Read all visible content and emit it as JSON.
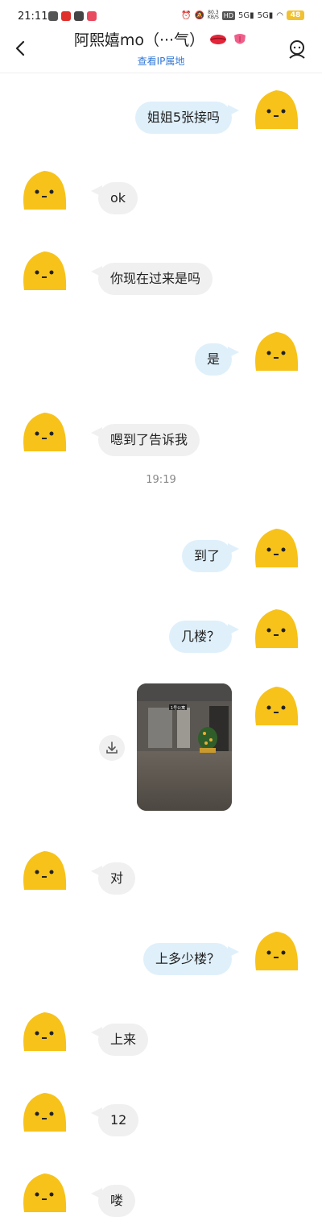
{
  "status_bar": {
    "time": "21:11",
    "app_icon_colors": [
      "#555555",
      "#e0302c",
      "#444444",
      "#e84a5f"
    ],
    "net_speed_value": "80.3",
    "net_speed_unit": "KB/S",
    "hd_badge": "HD",
    "signal1": "5G",
    "signal2": "5G",
    "battery": "48"
  },
  "header": {
    "title": "阿熙嬉mo（···气）",
    "subtitle": "查看IP属地",
    "emoji_icons": [
      "kiss-lips-icon",
      "tongue-icon"
    ]
  },
  "messages": [
    {
      "side": "out",
      "text": "姐姐5张接吗"
    },
    {
      "side": "in",
      "text": "ok"
    },
    {
      "side": "in",
      "text": "你现在过来是吗"
    },
    {
      "side": "out",
      "text": "是"
    },
    {
      "side": "in",
      "text": "嗯到了告诉我"
    },
    {
      "side": "out",
      "text": "到了"
    },
    {
      "side": "out",
      "text": "几楼？"
    },
    {
      "side": "in",
      "text": "对"
    },
    {
      "side": "out",
      "text": "上多少楼？"
    },
    {
      "side": "in",
      "text": "上来"
    },
    {
      "side": "in",
      "text": "12"
    },
    {
      "side": "in",
      "text": "喽"
    }
  ],
  "timestamp": "19:19",
  "photo_sign": "1号公寓",
  "colors": {
    "avatar_yellow": "#f7c21a",
    "bubble_out": "#dff0fb",
    "bubble_in": "#f0f0f0",
    "link_blue": "#3278d6"
  }
}
